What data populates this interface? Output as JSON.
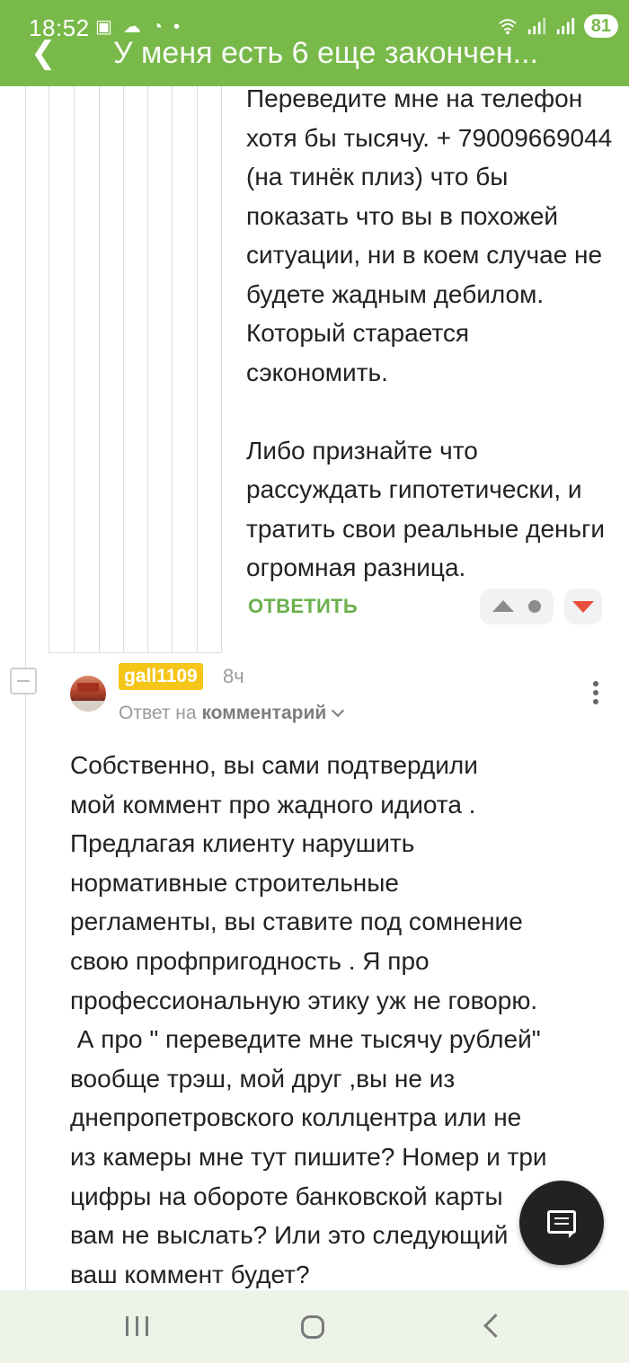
{
  "status_bar": {
    "time": "18:52",
    "battery": "81"
  },
  "header": {
    "title": "У меня есть 6 еще закончен...",
    "accent": "#78b94a"
  },
  "comment_1": {
    "paragraphs": [
      "Переведите мне на телефон хотя бы тысячу. + 79009669044 (на тинёк плиз) что бы показать что вы в похожей ситуации, ни в коем случае не будете жадным дебилом. Который старается сэкономить.",
      "Либо признайте что рассуждать гипотетически, и тратить свои реальные деньги огромная разница."
    ],
    "reply_label": "ОТВЕТИТЬ"
  },
  "comment_2": {
    "username": "gall1109",
    "time_ago": "8ч",
    "reply_to_prefix": "Ответ на",
    "reply_to_target": "комментарий",
    "paragraphs": [
      "Собственно, вы сами подтвердили",
      "мой коммент про жадного идиота .",
      "Предлагая клиенту нарушить",
      "нормативные строительные",
      "регламенты, вы ставите под сомнение",
      "свою профпригодность . Я про",
      "профессиональную этику уж не говорю.",
      " А про \" переведите мне тысячу рублей\"",
      "вообще трэш, мой друг ,вы не из",
      "днепропетровского коллцентра или не",
      "из камеры мне тут пишите? Номер и три",
      "цифры на обороте банковской карты",
      "вам не выслать? Или это следующий",
      "ваш коммент будет?"
    ]
  },
  "icons": {
    "fab": "comment-icon",
    "nav": [
      "recent-apps-icon",
      "home-icon",
      "back-icon"
    ]
  }
}
